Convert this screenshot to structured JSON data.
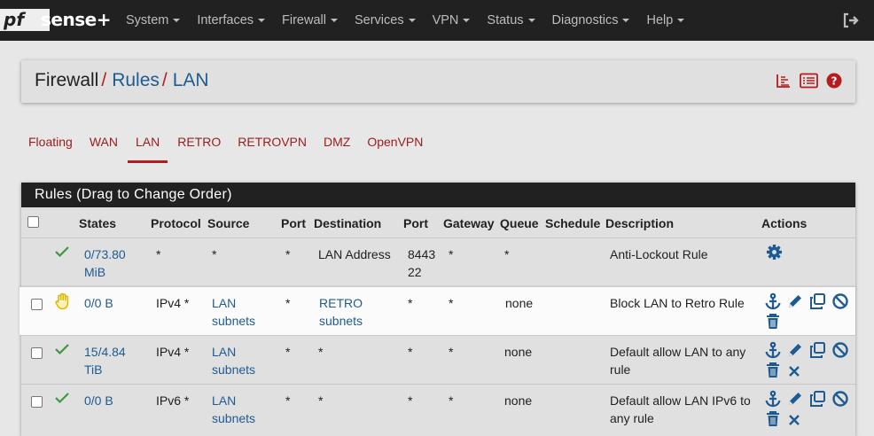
{
  "brand": {
    "logo_pf": "pf",
    "logo_sense": "sense",
    "logo_plus": "+"
  },
  "nav": {
    "items": [
      "System",
      "Interfaces",
      "Firewall",
      "Services",
      "VPN",
      "Status",
      "Diagnostics",
      "Help"
    ],
    "logout_icon": "sign-out-icon"
  },
  "breadcrumb": {
    "items": [
      "Firewall",
      "Rules",
      "LAN"
    ],
    "separator": "/"
  },
  "tabs": [
    "Floating",
    "WAN",
    "LAN",
    "RETRO",
    "RETROVPN",
    "DMZ",
    "OpenVPN"
  ],
  "active_tab": "LAN",
  "panel": {
    "title": "Rules (Drag to Change Order)",
    "columns": [
      "States",
      "Protocol",
      "Source",
      "Port",
      "Destination",
      "Port",
      "Gateway",
      "Queue",
      "Schedule",
      "Description",
      "Actions"
    ]
  },
  "rows": [
    {
      "status": "check",
      "states": [
        "0/73.80",
        "MiB"
      ],
      "protocol": "*",
      "source": [
        "*"
      ],
      "source_link": false,
      "sport": "*",
      "destination": [
        "LAN Address"
      ],
      "dest_link": false,
      "dport": [
        "8443",
        "22"
      ],
      "gateway": "*",
      "queue": "*",
      "schedule": "",
      "description": [
        "Anti-Lockout Rule"
      ],
      "has_checkbox": false
    },
    {
      "status": "hand",
      "states": [
        "0/0 B"
      ],
      "protocol": "IPv4 *",
      "source": [
        "LAN",
        "subnets"
      ],
      "source_link": true,
      "sport": "*",
      "destination": [
        "RETRO",
        "subnets"
      ],
      "dest_link": true,
      "dport": [
        "*"
      ],
      "gateway": "*",
      "queue": "none",
      "schedule": "",
      "description": [
        "Block LAN to Retro Rule"
      ],
      "has_checkbox": true
    },
    {
      "status": "check",
      "states": [
        "15/4.84",
        "TiB"
      ],
      "protocol": "IPv4 *",
      "source": [
        "LAN",
        "subnets"
      ],
      "source_link": true,
      "sport": "*",
      "destination": [
        "*"
      ],
      "dest_link": false,
      "dport": [
        "*"
      ],
      "gateway": "*",
      "queue": "none",
      "schedule": "",
      "description": [
        "Default allow LAN to any",
        "rule"
      ],
      "has_checkbox": true
    },
    {
      "status": "check",
      "states": [
        "0/0 B"
      ],
      "protocol": "IPv6 *",
      "source": [
        "LAN",
        "subnets"
      ],
      "source_link": true,
      "sport": "*",
      "destination": [
        "*"
      ],
      "dest_link": false,
      "dport": [
        "*"
      ],
      "gateway": "*",
      "queue": "none",
      "schedule": "",
      "description": [
        "Default allow LAN IPv6 to",
        "any rule"
      ],
      "has_checkbox": true
    }
  ],
  "colors": {
    "navbar": "#212121",
    "link": "#1e5b92",
    "accent_red": "#b71c1c",
    "check_green": "#3c9a3c",
    "hand_yellow": "#e0b400"
  }
}
